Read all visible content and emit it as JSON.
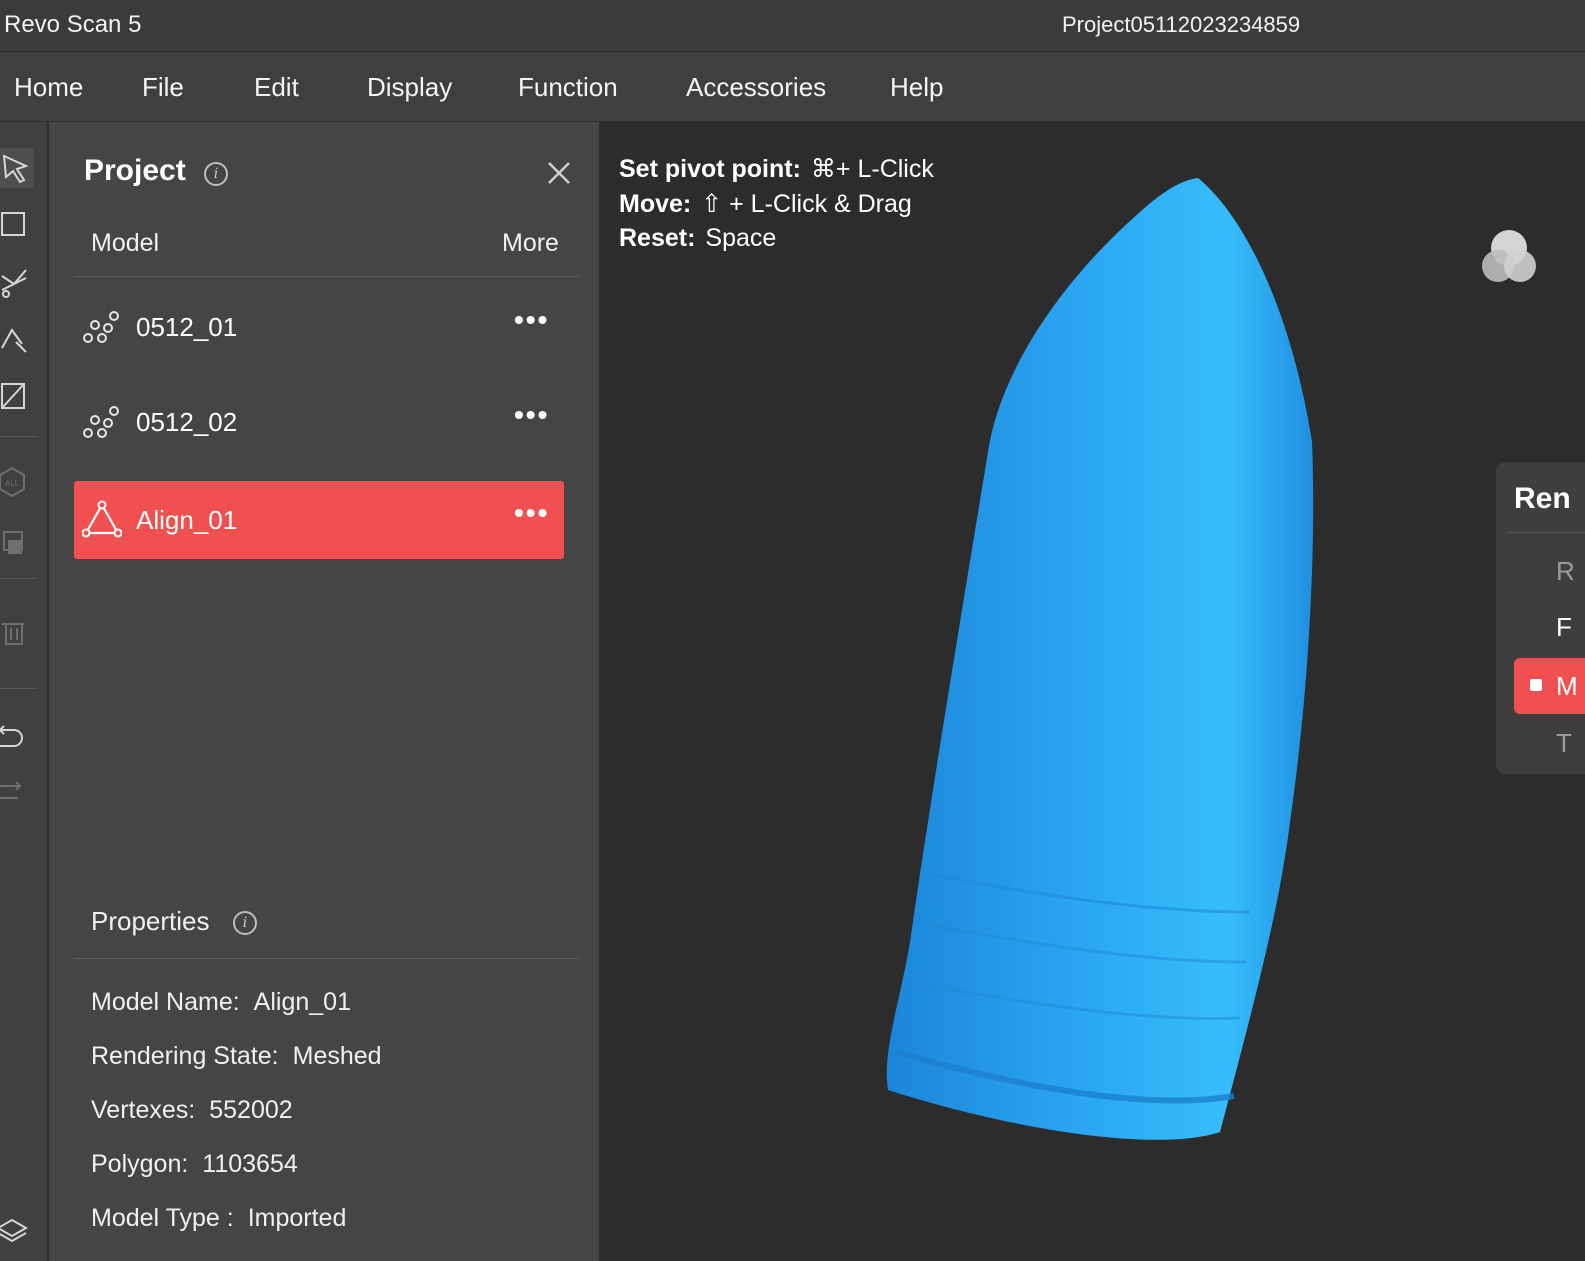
{
  "window": {
    "app_title": "Revo Scan 5",
    "project_title": "Project05112023234859"
  },
  "menu": {
    "items": [
      "Home",
      "File",
      "Edit",
      "Display",
      "Function",
      "Accessories",
      "Help"
    ]
  },
  "toolbar": {
    "icons": [
      "select-arrow-icon",
      "rectangle-select-icon",
      "lasso-select-icon",
      "brush-select-icon",
      "invert-select-icon",
      "select-all-icon",
      "select-connected-icon",
      "delete-icon",
      "undo-icon",
      "redo-icon",
      "layers-icon"
    ]
  },
  "project_panel": {
    "title": "Project",
    "info_glyph": "i",
    "column_model": "Model",
    "column_more": "More",
    "models": [
      {
        "name": "0512_01",
        "icon": "point-cloud-icon",
        "more": "•••",
        "selected": false
      },
      {
        "name": "0512_02",
        "icon": "point-cloud-icon",
        "more": "•••",
        "selected": false
      },
      {
        "name": "Align_01",
        "icon": "mesh-triangle-icon",
        "more": "•••",
        "selected": true
      }
    ]
  },
  "properties": {
    "title": "Properties",
    "info_glyph": "i",
    "model_name_label": "Model Name:",
    "model_name_value": "Align_01",
    "rendering_state_label": "Rendering State:",
    "rendering_state_value": "Meshed",
    "vertexes_label": "Vertexes:",
    "vertexes_value": "552002",
    "polygon_label": "Polygon:",
    "polygon_value": "1103654",
    "model_type_label": "Model Type :",
    "model_type_value": "Imported"
  },
  "viewport": {
    "hint_pivot_label": "Set pivot point:",
    "hint_pivot_value": "⌘+ L-Click",
    "hint_move_label": "Move:",
    "hint_move_value": "⇧ + L-Click & Drag",
    "hint_reset_label": "Reset:",
    "hint_reset_value": "Space",
    "model_color": "#2da3f0",
    "accent_color": "#f0504f"
  },
  "render_panel": {
    "title": "Ren",
    "item_1": "R",
    "item_2": "F",
    "item_selected": "M",
    "item_4": "T"
  }
}
